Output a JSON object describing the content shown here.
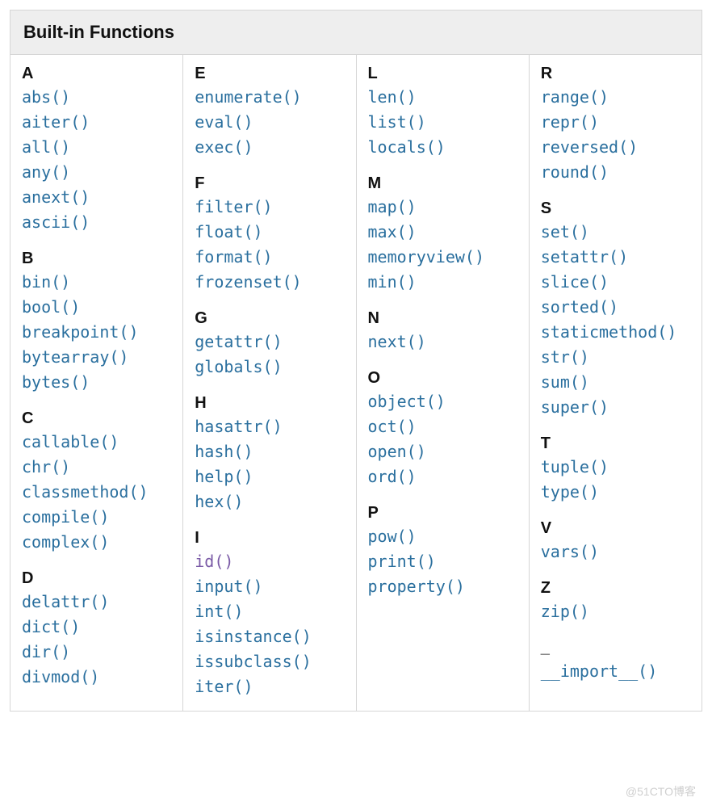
{
  "title": "Built-in Functions",
  "watermark": "@51CTO博客",
  "visited": [
    "id()"
  ],
  "columns": [
    [
      {
        "letter": "A",
        "items": [
          "abs()",
          "aiter()",
          "all()",
          "any()",
          "anext()",
          "ascii()"
        ]
      },
      {
        "letter": "B",
        "items": [
          "bin()",
          "bool()",
          "breakpoint()",
          "bytearray()",
          "bytes()"
        ]
      },
      {
        "letter": "C",
        "items": [
          "callable()",
          "chr()",
          "classmethod()",
          "compile()",
          "complex()"
        ]
      },
      {
        "letter": "D",
        "items": [
          "delattr()",
          "dict()",
          "dir()",
          "divmod()"
        ]
      }
    ],
    [
      {
        "letter": "E",
        "items": [
          "enumerate()",
          "eval()",
          "exec()"
        ]
      },
      {
        "letter": "F",
        "items": [
          "filter()",
          "float()",
          "format()",
          "frozenset()"
        ]
      },
      {
        "letter": "G",
        "items": [
          "getattr()",
          "globals()"
        ]
      },
      {
        "letter": "H",
        "items": [
          "hasattr()",
          "hash()",
          "help()",
          "hex()"
        ]
      },
      {
        "letter": "I",
        "items": [
          "id()",
          "input()",
          "int()",
          "isinstance()",
          "issubclass()",
          "iter()"
        ]
      }
    ],
    [
      {
        "letter": "L",
        "items": [
          "len()",
          "list()",
          "locals()"
        ]
      },
      {
        "letter": "M",
        "items": [
          "map()",
          "max()",
          "memoryview()",
          "min()"
        ]
      },
      {
        "letter": "N",
        "items": [
          "next()"
        ]
      },
      {
        "letter": "O",
        "items": [
          "object()",
          "oct()",
          "open()",
          "ord()"
        ]
      },
      {
        "letter": "P",
        "items": [
          "pow()",
          "print()",
          "property()"
        ]
      }
    ],
    [
      {
        "letter": "R",
        "items": [
          "range()",
          "repr()",
          "reversed()",
          "round()"
        ]
      },
      {
        "letter": "S",
        "items": [
          "set()",
          "setattr()",
          "slice()",
          "sorted()",
          "staticmethod()",
          "str()",
          "sum()",
          "super()"
        ]
      },
      {
        "letter": "T",
        "items": [
          "tuple()",
          "type()"
        ]
      },
      {
        "letter": "V",
        "items": [
          "vars()"
        ]
      },
      {
        "letter": "Z",
        "items": [
          "zip()"
        ]
      },
      {
        "letter": "_",
        "items": [
          "__import__()"
        ]
      }
    ]
  ]
}
